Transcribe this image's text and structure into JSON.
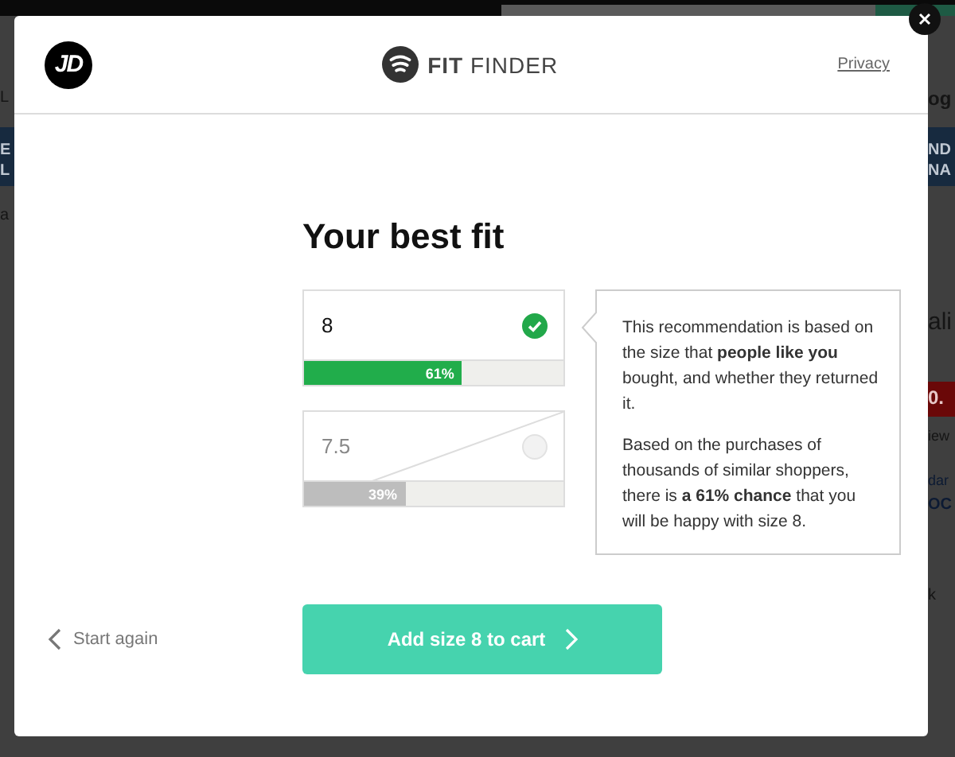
{
  "background_page": {
    "left_fragments": [
      "L",
      "E",
      "L",
      "a"
    ],
    "right_fragments": [
      "og",
      "ND",
      "NA",
      "ali",
      "0.",
      "iew",
      "dar",
      "OC",
      "k"
    ]
  },
  "header": {
    "logo": "JD",
    "product": "**FIT** FINDER",
    "privacy_link": "Privacy"
  },
  "title": "Your best fit",
  "sizes": [
    {
      "size": "8",
      "selected": true,
      "level": 0.61,
      "percent": "61%"
    },
    {
      "size": "7.5",
      "selected": false,
      "level": 0.39,
      "percent": "39%"
    }
  ],
  "explanation": [
    "This recommendation is based on the size that **people like you** bought, and whether they returned it.",
    "Based on the purchases of thousands of similar shoppers, there is **a 61% chance** that you will be happy with size 8."
  ],
  "start_again": "Start again",
  "add_button": "Add size 8 to cart"
}
